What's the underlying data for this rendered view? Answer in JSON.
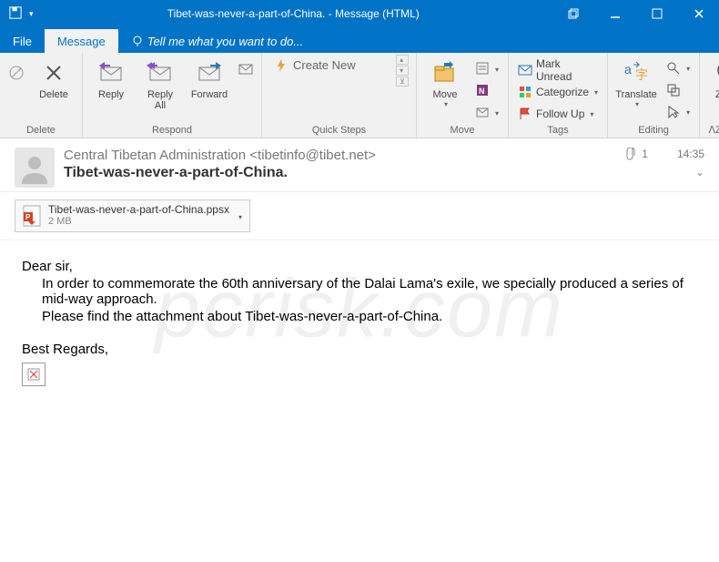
{
  "titlebar": {
    "title": "Tibet-was-never-a-part-of-China. - Message (HTML)"
  },
  "tabs": {
    "file": "File",
    "message": "Message",
    "tellme": "Tell me what you want to do..."
  },
  "ribbon": {
    "delete": {
      "delete": "Delete",
      "label": "Delete"
    },
    "respond": {
      "reply": "Reply",
      "replyall": "Reply\nAll",
      "forward": "Forward",
      "label": "Respond"
    },
    "quicksteps": {
      "create": "Create New",
      "label": "Quick Steps"
    },
    "move": {
      "move": "Move",
      "label": "Move"
    },
    "tags": {
      "unread": "Mark Unread",
      "categorize": "Categorize",
      "followup": "Follow Up",
      "label": "Tags"
    },
    "editing": {
      "translate": "Translate",
      "label": "Editing"
    },
    "zoom": {
      "zoom": "Zoom",
      "label": "Zoom"
    }
  },
  "message": {
    "from_name": "Central Tibetan Administration",
    "from_email": "<tibetinfo@tibet.net>",
    "subject": "Tibet-was-never-a-part-of-China.",
    "time": "14:35",
    "attach_count": "1",
    "attachment": {
      "name": "Tibet-was-never-a-part-of-China.ppsx",
      "size": "2 MB"
    },
    "body": {
      "greeting": "Dear sir,",
      "line1": "In order to commemorate the 60th anniversary of the Dalai Lama's exile, we specially produced a series of mid-way approach.",
      "line2": "Please find the attachment about Tibet-was-never-a-part-of-China.",
      "signoff": "Best Regards,"
    }
  },
  "watermark": "pcrisk.com"
}
